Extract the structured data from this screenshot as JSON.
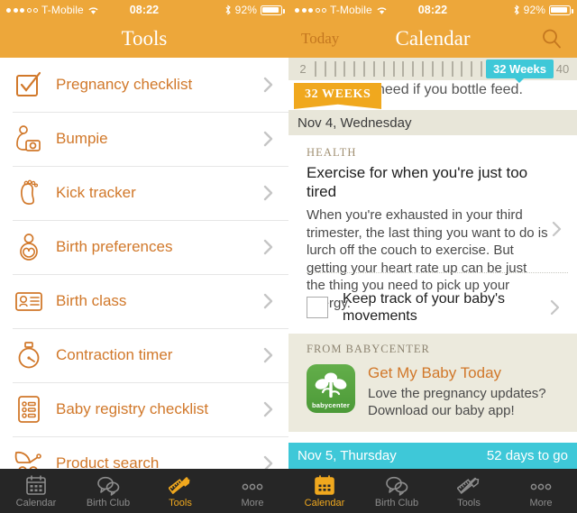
{
  "statusbar": {
    "carrier": "T-Mobile",
    "time": "08:22",
    "battery": "92%",
    "signal_filled": 3,
    "signal_total": 5,
    "wifi_icon": "wifi-icon",
    "bluetooth_icon": "bluetooth-icon",
    "battery_icon": "battery-icon"
  },
  "colors": {
    "orange_bar": "#eda73a",
    "accent_orange": "#d1782a",
    "ribbon_orange": "#f0a81e",
    "teal": "#3ec8d8",
    "khaki": "#e8e6d9",
    "promo_bg": "#eceadd",
    "tabbar": "#262626",
    "tab_active": "#f0a81e",
    "babycenter_green": "#4c9a38"
  },
  "left_screen": {
    "nav": {
      "title": "Tools"
    },
    "tools": [
      {
        "label": "Pregnancy checklist",
        "icon": "checklist-icon"
      },
      {
        "label": "Bumpie",
        "icon": "bump-camera-icon"
      },
      {
        "label": "Kick tracker",
        "icon": "footprint-icon"
      },
      {
        "label": "Birth preferences",
        "icon": "pregnant-woman-icon"
      },
      {
        "label": "Birth class",
        "icon": "birth-class-card-icon"
      },
      {
        "label": "Contraction timer",
        "icon": "stopwatch-icon"
      },
      {
        "label": "Baby registry checklist",
        "icon": "registry-list-icon"
      },
      {
        "label": "Product search",
        "icon": "stroller-icon"
      }
    ],
    "chevron_icon": "chevron-right-icon",
    "tabs": [
      {
        "label": "Calendar",
        "icon": "calendar-icon",
        "active": false
      },
      {
        "label": "Birth Club",
        "icon": "chat-bubbles-icon",
        "active": false
      },
      {
        "label": "Tools",
        "icon": "ruler-pencil-icon",
        "active": true
      },
      {
        "label": "More",
        "icon": "ellipsis-icon",
        "active": false
      }
    ]
  },
  "right_screen": {
    "nav": {
      "back_label": "Today",
      "title": "Calendar",
      "search_icon": "search-icon"
    },
    "week_slider": {
      "min_label": "2",
      "max_label": "40",
      "tooltip": "32 Weeks",
      "tick_count": 25
    },
    "ribbon_badge": "32 WEEKS",
    "partial_text_above": "need if you bottle feed.",
    "date_header": "Nov 4, Wednesday",
    "article": {
      "kicker": "HEALTH",
      "headline": "Exercise for when you're just too tired",
      "body": "When you're exhausted in your third trimester, the last thing you want to do is lurch off the couch to exercise. But getting your heart rate up can be just the thing you need to pick up your energy.",
      "chevron_icon": "chevron-right-icon"
    },
    "task": {
      "label": "Keep track of your baby's movements",
      "checked": false,
      "checkbox_icon": "checkbox-unchecked-icon",
      "chevron_icon": "chevron-right-icon"
    },
    "promo": {
      "kicker": "FROM BABYCENTER",
      "app_icon_label": "babycenter",
      "title": "Get My Baby Today",
      "subtitle": "Love the pregnancy updates? Download our baby app!"
    },
    "footer": {
      "date": "Nov 5, Thursday",
      "countdown": "52 days to go"
    },
    "tabs": [
      {
        "label": "Calendar",
        "icon": "calendar-icon",
        "active": true
      },
      {
        "label": "Birth Club",
        "icon": "chat-bubbles-icon",
        "active": false
      },
      {
        "label": "Tools",
        "icon": "ruler-pencil-icon",
        "active": false
      },
      {
        "label": "More",
        "icon": "ellipsis-icon",
        "active": false
      }
    ]
  }
}
